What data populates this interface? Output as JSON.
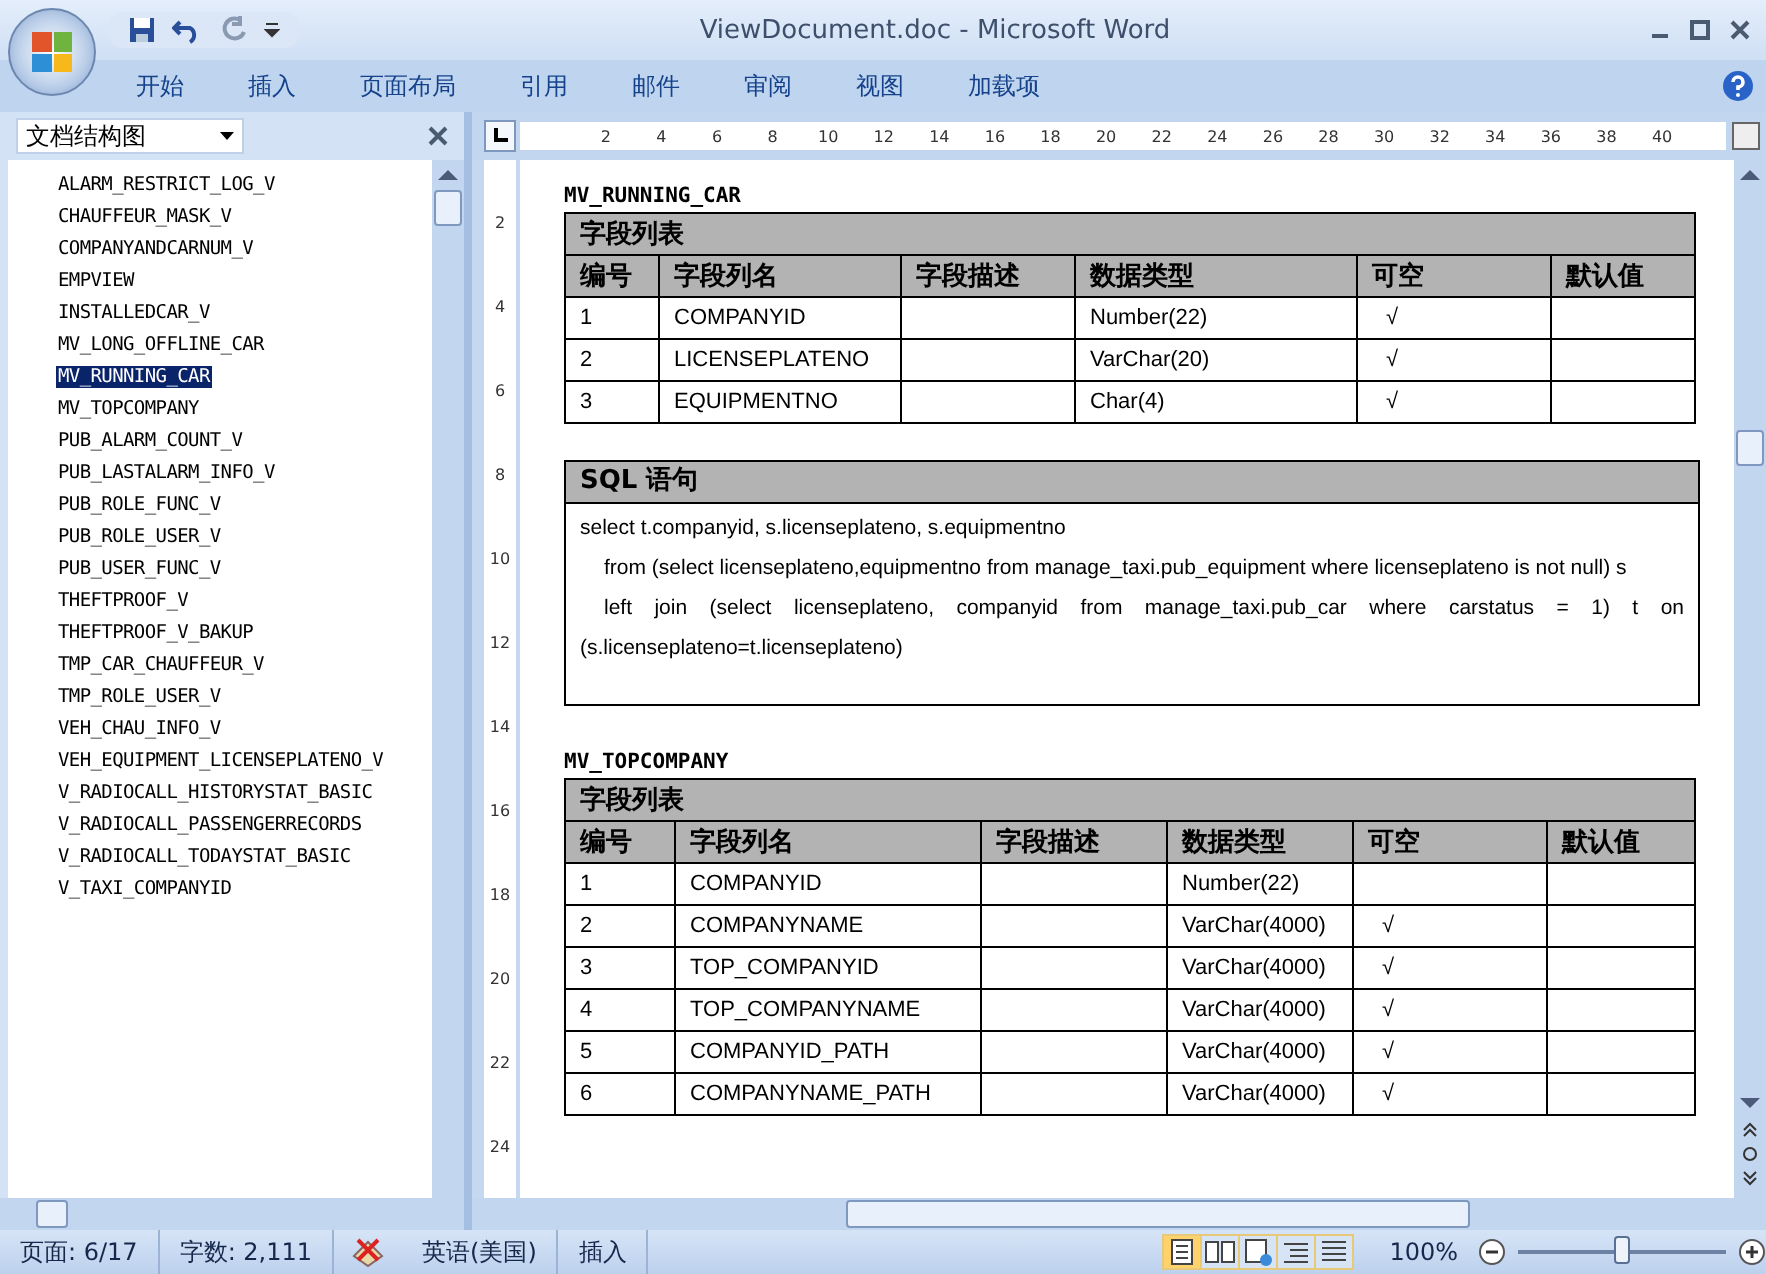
{
  "window": {
    "title": "ViewDocument.doc - Microsoft Word"
  },
  "ribbon_tabs": [
    "开始",
    "插入",
    "页面布局",
    "引用",
    "邮件",
    "审阅",
    "视图",
    "加载项"
  ],
  "nav_pane": {
    "title": "文档结构图",
    "items": [
      {
        "label": "ALARM_RESTRICT_LOG_V",
        "selected": false
      },
      {
        "label": "CHAUFFEUR_MASK_V",
        "selected": false
      },
      {
        "label": "COMPANYANDCARNUM_V",
        "selected": false
      },
      {
        "label": "EMPVIEW",
        "selected": false
      },
      {
        "label": "INSTALLEDCAR_V",
        "selected": false
      },
      {
        "label": "MV_LONG_OFFLINE_CAR",
        "selected": false
      },
      {
        "label": "MV_RUNNING_CAR",
        "selected": true
      },
      {
        "label": "MV_TOPCOMPANY",
        "selected": false
      },
      {
        "label": "PUB_ALARM_COUNT_V",
        "selected": false
      },
      {
        "label": "PUB_LASTALARM_INFO_V",
        "selected": false
      },
      {
        "label": "PUB_ROLE_FUNC_V",
        "selected": false
      },
      {
        "label": "PUB_ROLE_USER_V",
        "selected": false
      },
      {
        "label": "PUB_USER_FUNC_V",
        "selected": false
      },
      {
        "label": "THEFTPROOF_V",
        "selected": false
      },
      {
        "label": "THEFTPROOF_V_BAKUP",
        "selected": false
      },
      {
        "label": "TMP_CAR_CHAUFFEUR_V",
        "selected": false
      },
      {
        "label": "TMP_ROLE_USER_V",
        "selected": false
      },
      {
        "label": "VEH_CHAU_INFO_V",
        "selected": false
      },
      {
        "label": "VEH_EQUIPMENT_LICENSEPLATENO_V",
        "selected": false
      },
      {
        "label": "V_RADIOCALL_HISTORYSTAT_BASIC",
        "selected": false
      },
      {
        "label": "V_RADIOCALL_PASSENGERRECORDS",
        "selected": false
      },
      {
        "label": "V_RADIOCALL_TODAYSTAT_BASIC",
        "selected": false
      },
      {
        "label": "V_TAXI_COMPANYID",
        "selected": false
      }
    ]
  },
  "ruler": {
    "horizontal": [
      "2",
      "4",
      "6",
      "8",
      "10",
      "12",
      "14",
      "16",
      "18",
      "20",
      "22",
      "24",
      "26",
      "28",
      "30",
      "32",
      "34",
      "36",
      "38",
      "40"
    ],
    "vertical": [
      "2",
      "4",
      "6",
      "8",
      "10",
      "12",
      "14",
      "16",
      "18",
      "20",
      "22",
      "24"
    ]
  },
  "document": [
    {
      "kind": "heading",
      "text": "MV_RUNNING_CAR"
    },
    {
      "kind": "table",
      "caption": "字段列表",
      "columns": [
        "编号",
        "字段列名",
        "字段描述",
        "数据类型",
        "可空",
        "默认值"
      ],
      "rows": [
        [
          "1",
          "COMPANYID",
          "",
          "Number(22)",
          "√",
          ""
        ],
        [
          "2",
          "LICENSEPLATENO",
          "",
          "VarChar(20)",
          "√",
          ""
        ],
        [
          "3",
          "EQUIPMENTNO",
          "",
          "Char(4)",
          "√",
          ""
        ]
      ]
    },
    {
      "kind": "sql",
      "caption": "SQL 语句",
      "lines": [
        "select t.companyid, s.licenseplateno, s.equipmentno",
        "from (select licenseplateno,equipmentno from manage_taxi.pub_equipment where licenseplateno is not null) s",
        "left join (select licenseplateno, companyid from manage_taxi.pub_car where carstatus = 1) t on (s.licenseplateno=t.licenseplateno)"
      ]
    },
    {
      "kind": "heading",
      "text": "MV_TOPCOMPANY"
    },
    {
      "kind": "table",
      "caption": "字段列表",
      "columns": [
        "编号",
        "字段列名",
        "字段描述",
        "数据类型",
        "可空",
        "默认值"
      ],
      "rows": [
        [
          "1",
          "COMPANYID",
          "",
          "Number(22)",
          "",
          ""
        ],
        [
          "2",
          "COMPANYNAME",
          "",
          "VarChar(4000)",
          "√",
          ""
        ],
        [
          "3",
          "TOP_COMPANYID",
          "",
          "VarChar(4000)",
          "√",
          ""
        ],
        [
          "4",
          "TOP_COMPANYNAME",
          "",
          "VarChar(4000)",
          "√",
          ""
        ],
        [
          "5",
          "COMPANYID_PATH",
          "",
          "VarChar(4000)",
          "√",
          ""
        ],
        [
          "6",
          "COMPANYNAME_PATH",
          "",
          "VarChar(4000)",
          "√",
          ""
        ]
      ]
    }
  ],
  "status_bar": {
    "page": "页面: 6/17",
    "words": "字数: 2,111",
    "language": "英语(美国)",
    "mode": "插入",
    "zoom": "100%",
    "zoom_slider": {
      "level": 0.5
    }
  }
}
